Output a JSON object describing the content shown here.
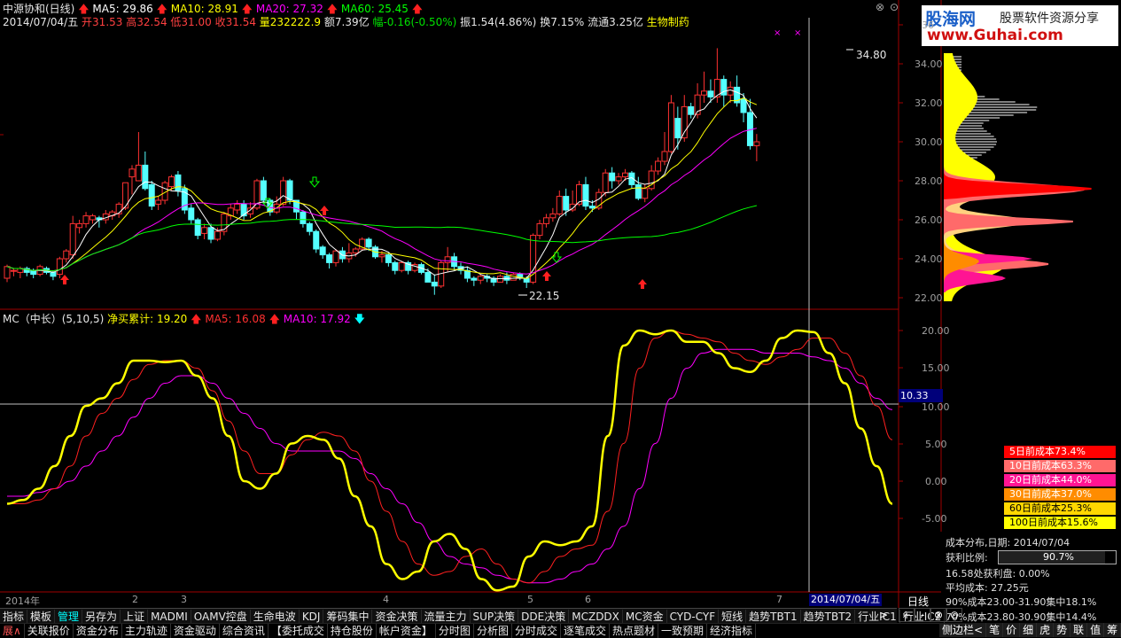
{
  "header": {
    "title": "中源协和(日线)",
    "ma5": "MA5: 29.86",
    "ma10": "MA10: 28.91",
    "ma20": "MA20: 27.32",
    "ma60": "MA60: 25.45",
    "date": "2014/07/04/五",
    "open": "开31.53",
    "high": "高32.54",
    "low": "低31.00",
    "close": "收31.54",
    "vol": "量232222.9",
    "amount": "额7.39亿",
    "change": "幅-0.16(-0.50%)",
    "amp": "振1.54(4.86%)",
    "turn": "换7.15%",
    "float": "流通3.25亿",
    "industry": "生物制药"
  },
  "watermark": {
    "site": "股海网",
    "slogan": "股票软件资源分享",
    "url": "www.Guhai.com"
  },
  "price_axis": [
    "36",
    "34.00",
    "32.00",
    "30.00",
    "28.00",
    "26.00",
    "24.00",
    "22.00"
  ],
  "peak_label": "34.80",
  "trough_label": "22.15",
  "indicator": {
    "name": "MC（中长）(5,10,5)",
    "net": "净买累计: 19.20",
    "ma5": "MA5: 16.08",
    "ma10": "MA10: 17.92",
    "axis": [
      "20.00",
      "15.00",
      "10.00",
      "5.00",
      "0.00",
      "-5.00"
    ],
    "cursor_value": "10.33"
  },
  "time_axis": {
    "year": "2014年",
    "months": [
      "2",
      "3",
      "4",
      "5",
      "6",
      "7"
    ],
    "cursor_date": "2014/07/04/五",
    "period": "日线"
  },
  "cost_legend": [
    {
      "label": "5日前成本73.4%",
      "color": "#ff0000"
    },
    {
      "label": "10日前成本63.3%",
      "color": "#ff6a6a"
    },
    {
      "label": "20日前成本44.0%",
      "color": "#ff1493"
    },
    {
      "label": "30日前成本37.0%",
      "color": "#ff8c00"
    },
    {
      "label": "60日前成本25.3%",
      "color": "#ffd700"
    },
    {
      "label": "100日前成本15.6%",
      "color": "#ffff00"
    }
  ],
  "cost_info": {
    "title": "成本分布,日期: 2014/07/04",
    "profit_label": "获利比例:",
    "profit_value": "90.7%",
    "profit_plate": "16.58处获利盘: 0.00%",
    "avg": "平均成本: 27.25元",
    "c90": "90%成本23.00-31.90集中18.1%",
    "c70": "70%成本23.80-30.90集中14.4%"
  },
  "tabs_row1": [
    "指标",
    "模板",
    "管理",
    "另存为",
    "上证",
    "MADMI",
    "OAMV控盘",
    "生命电波",
    "KDJ",
    "筹码集中",
    "资金决策",
    "流量主力",
    "SUP决策",
    "DDE决策",
    "MCZDDX",
    "MC资金",
    "CYD-CYF",
    "短线",
    "趋势TBT1",
    "趋势TBT2",
    "行业IC1",
    "行业IC2"
  ],
  "tabs_row2": [
    "展∧",
    "关联报价",
    "资金分布",
    "主力轨迹",
    "资金驱动",
    "综合资讯",
    "【委托成交",
    "持仓股份",
    "帐户资金】",
    "分时图",
    "分析图",
    "分时成交",
    "逐笔成交",
    "热点题材",
    "一致预期",
    "经济指标"
  ],
  "right_tabs": [
    "侧边栏<",
    "笔",
    "价",
    "细",
    "虎",
    "势",
    "联",
    "值",
    "筹"
  ],
  "ctrl_buttons": [
    "+",
    "-",
    "⊗",
    "⊙"
  ],
  "colors": {
    "up": "#ff3232",
    "down": "#54ffff",
    "ma5": "#ffffff",
    "ma10": "#ffff00",
    "ma20": "#ff00ff",
    "ma60": "#00ff00"
  }
}
